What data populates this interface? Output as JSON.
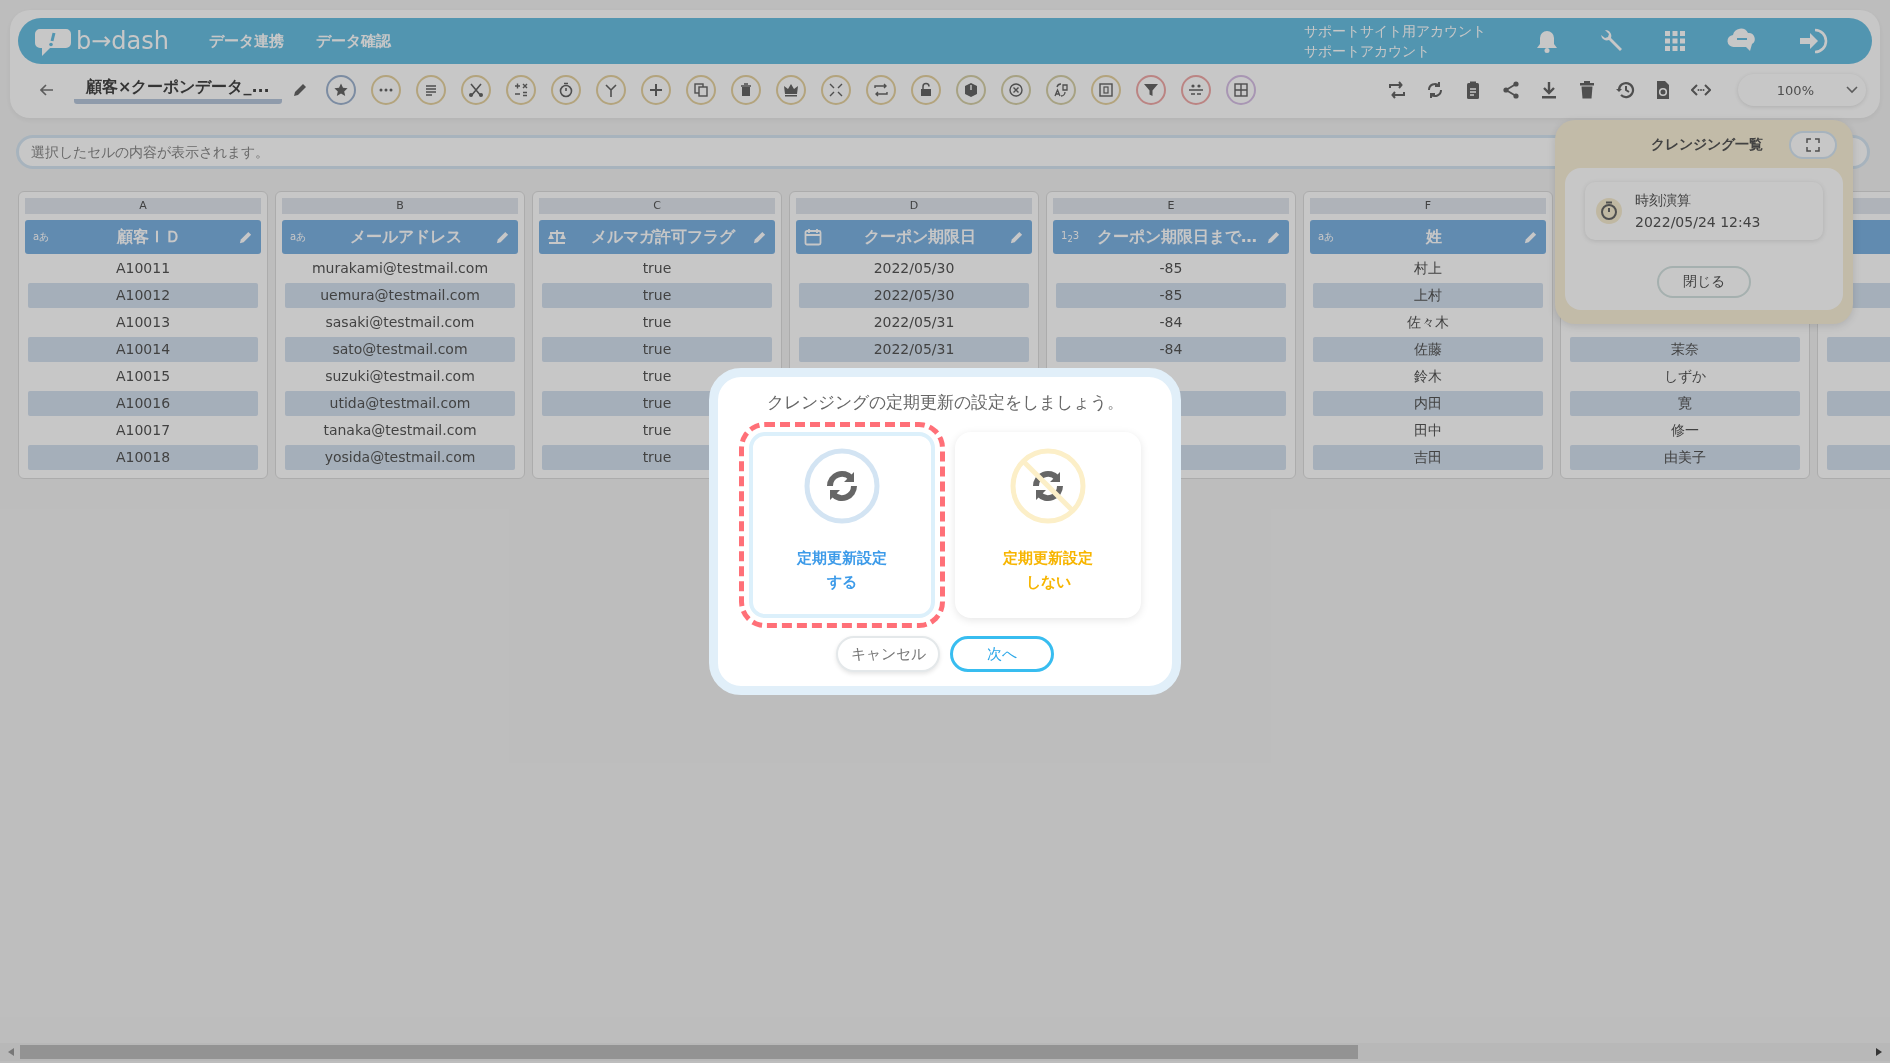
{
  "header": {
    "logo": "b→dash",
    "nav": [
      {
        "label": "データ連携"
      },
      {
        "label": "データ確認"
      }
    ],
    "account": [
      "サポートサイト用アカウント",
      "サポートアカウント"
    ]
  },
  "toolbar": {
    "title": "顧客×クーポンデータ_...",
    "zoom": "100%"
  },
  "cell_bar": {
    "placeholder": "選択したセルの内容が表示されます。"
  },
  "columns": [
    {
      "letter": "A",
      "kind": "text",
      "type_label": "aあ",
      "name": "顧客ＩＤ",
      "values": [
        "A10011",
        "A10012",
        "A10013",
        "A10014",
        "A10015",
        "A10016",
        "A10017",
        "A10018"
      ]
    },
    {
      "letter": "B",
      "kind": "text",
      "type_label": "aあ",
      "name": "メールアドレス",
      "values": [
        "murakami@testmail.com",
        "uemura@testmail.com",
        "sasaki@testmail.com",
        "sato@testmail.com",
        "suzuki@testmail.com",
        "utida@testmail.com",
        "tanaka@testmail.com",
        "yosida@testmail.com"
      ]
    },
    {
      "letter": "C",
      "kind": "bool",
      "name": "メルマガ許可フラグ",
      "values": [
        "true",
        "true",
        "true",
        "true",
        "true",
        "true",
        "true",
        "true"
      ]
    },
    {
      "letter": "D",
      "kind": "date",
      "name": "クーポン期限日",
      "values": [
        "2022/05/30",
        "2022/05/30",
        "2022/05/31",
        "2022/05/31"
      ]
    },
    {
      "letter": "E",
      "kind": "number",
      "type_label": "1$_{2}$3",
      "name": "クーポン期限日まで…",
      "values": [
        "-85",
        "-85",
        "-84",
        "-84"
      ]
    },
    {
      "letter": "F",
      "kind": "text",
      "type_label": "aあ",
      "name": "姓",
      "values": [
        "村上",
        "上村",
        "佐々木",
        "佐藤",
        "鈴木",
        "内田",
        "田中",
        "吉田"
      ]
    },
    {
      "kind": "hidden",
      "values": [
        "茉奈",
        "しずか",
        "寛",
        "修一",
        "由美子"
      ]
    }
  ],
  "cleansing_panel": {
    "title": "クレンジング一覧",
    "items": [
      {
        "name": "時刻演算",
        "time": "2022/05/24 12:43"
      }
    ],
    "close": "閉じる"
  },
  "modal": {
    "title": "クレンジングの定期更新の設定をしましょう。",
    "options": [
      {
        "kind": "on",
        "lines": [
          "定期更新設定",
          "する"
        ],
        "color": "#3d9be9",
        "selected": true
      },
      {
        "kind": "off",
        "lines": [
          "定期更新設定",
          "しない"
        ],
        "color": "#f7b500",
        "selected": false
      }
    ],
    "buttons": [
      {
        "label": "キャンセル",
        "kind": "secondary"
      },
      {
        "label": "次へ",
        "kind": "primary"
      }
    ]
  }
}
